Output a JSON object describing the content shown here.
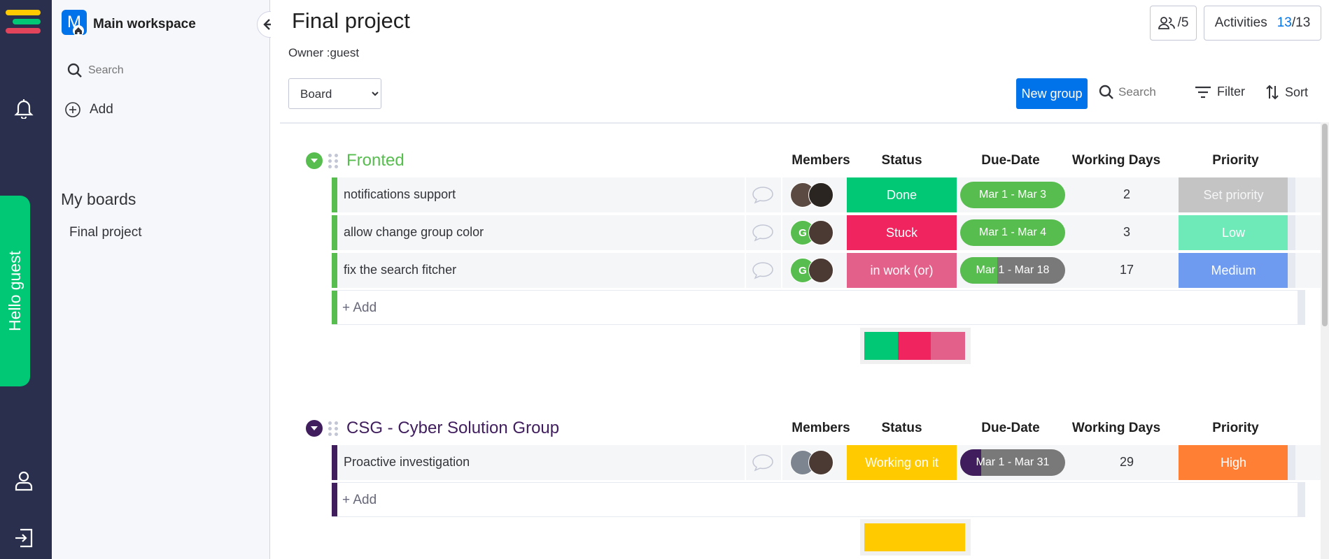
{
  "rail": {
    "hello_text": "Hello guest",
    "logo_colors": [
      "#ffcb00",
      "#00c875",
      "#e2445c"
    ]
  },
  "workspace": {
    "avatar_letter": "M",
    "title": "Main workspace",
    "search_placeholder": "Search",
    "add_label": "Add",
    "my_boards_label": "My boards",
    "boards": [
      "Final project"
    ]
  },
  "header": {
    "title": "Final project",
    "owner": "Owner :guest",
    "members_count": "/5",
    "activities_label": "Activities",
    "activities_current": "13",
    "activities_total": "/13"
  },
  "toolbar": {
    "view_options": [
      "Board"
    ],
    "view_selected": "Board",
    "new_group_label": "New group",
    "search_placeholder": "Search",
    "filter_label": "Filter",
    "sort_label": "Sort"
  },
  "columns": {
    "members": "Members",
    "status": "Status",
    "due_date": "Due-Date",
    "working_days": "Working Days",
    "priority": "Priority"
  },
  "groups": [
    {
      "title": "Fronted",
      "color": "#57bd4f",
      "add_label": "+ Add",
      "items": [
        {
          "name": "notifications support",
          "members": [
            {
              "type": "photo"
            },
            {
              "type": "photo"
            }
          ],
          "status": "Done",
          "status_color": "#00c875",
          "date": "Mar 1 - Mar 3",
          "date_progress": 1.0,
          "working_days": "2",
          "priority": "Set priority",
          "priority_color": "#c4c4c4"
        },
        {
          "name": "allow change group color",
          "members": [
            {
              "type": "letter",
              "letter": "G"
            },
            {
              "type": "photo"
            }
          ],
          "status": "Stuck",
          "status_color": "#f0255f",
          "date": "Mar 1 - Mar 4",
          "date_progress": 1.0,
          "working_days": "3",
          "priority": "Low",
          "priority_color": "#6eeab8",
          "priority_text_color": "#ffffff"
        },
        {
          "name": "fix the search fitcher",
          "members": [
            {
              "type": "letter",
              "letter": "G"
            },
            {
              "type": "photo"
            }
          ],
          "status": "in work (or)",
          "status_color": "#e2608a",
          "date": "Mar 1 - Mar 18",
          "date_progress": 0.35,
          "working_days": "17",
          "priority": "Medium",
          "priority_color": "#6e9af0"
        }
      ],
      "summary_colors": [
        "#00c875",
        "#f0255f",
        "#e2608a"
      ]
    },
    {
      "title": "CSG - Cyber Solution Group",
      "color": "#401e5e",
      "add_label": "+ Add",
      "items": [
        {
          "name": "Proactive investigation",
          "members": [
            {
              "type": "photo"
            },
            {
              "type": "photo"
            }
          ],
          "status": "Working on it",
          "status_color": "#ffcb00",
          "date": "Mar 1 - Mar 31",
          "date_progress": 0.2,
          "working_days": "29",
          "priority": "High",
          "priority_color": "#ff7f35"
        }
      ],
      "summary_colors": [
        "#ffcb00"
      ]
    }
  ]
}
